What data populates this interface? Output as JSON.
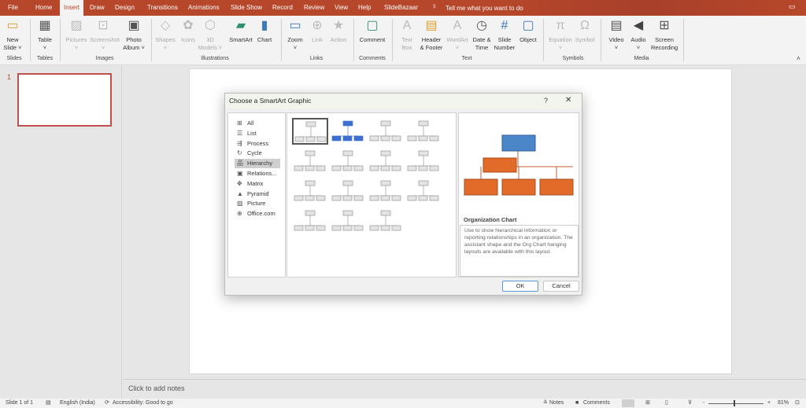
{
  "tabs": [
    "File",
    "Home",
    "Insert",
    "Draw",
    "Design",
    "Transitions",
    "Animations",
    "Slide Show",
    "Record",
    "Review",
    "View",
    "Help",
    "SlideBazaar"
  ],
  "active_tab": "Insert",
  "tell_me": "Tell me what you want to do",
  "ribbon": {
    "buttons": [
      {
        "label": "New\nSlide ˅",
        "icon": "new-slide-icon",
        "enabled": true
      },
      {
        "label": "Table\n˅",
        "icon": "table-icon",
        "enabled": true
      },
      {
        "label": "Pictures\n˅",
        "icon": "pictures-icon",
        "enabled": false
      },
      {
        "label": "Screenshot\n˅",
        "icon": "screenshot-icon",
        "enabled": false
      },
      {
        "label": "Photo\nAlbum ˅",
        "icon": "photo-album-icon",
        "enabled": true
      },
      {
        "label": "Shapes\n˅",
        "icon": "shapes-icon",
        "enabled": false
      },
      {
        "label": "Icons",
        "icon": "icons-icon",
        "enabled": false
      },
      {
        "label": "3D\nModels ˅",
        "icon": "3d-models-icon",
        "enabled": false
      },
      {
        "label": "SmartArt",
        "icon": "smartart-icon",
        "enabled": true
      },
      {
        "label": "Chart",
        "icon": "chart-icon",
        "enabled": true
      },
      {
        "label": "Zoom\n˅",
        "icon": "zoom-icon",
        "enabled": true
      },
      {
        "label": "Link",
        "icon": "link-icon",
        "enabled": false
      },
      {
        "label": "Action",
        "icon": "action-icon",
        "enabled": false
      },
      {
        "label": "Comment",
        "icon": "comment-icon",
        "enabled": true
      },
      {
        "label": "Text\nBox",
        "icon": "text-box-icon",
        "enabled": false
      },
      {
        "label": "Header\n& Footer",
        "icon": "header-footer-icon",
        "enabled": true
      },
      {
        "label": "WordArt\n˅",
        "icon": "wordart-icon",
        "enabled": false
      },
      {
        "label": "Date &\nTime",
        "icon": "date-time-icon",
        "enabled": true
      },
      {
        "label": "Slide\nNumber",
        "icon": "slide-number-icon",
        "enabled": true
      },
      {
        "label": "Object",
        "icon": "object-icon",
        "enabled": true
      },
      {
        "label": "Equation\n˅",
        "icon": "equation-icon",
        "enabled": false
      },
      {
        "label": "Symbol",
        "icon": "symbol-icon",
        "enabled": false
      },
      {
        "label": "Video\n˅",
        "icon": "video-icon",
        "enabled": true
      },
      {
        "label": "Audio\n˅",
        "icon": "audio-icon",
        "enabled": true
      },
      {
        "label": "Screen\nRecording",
        "icon": "screen-recording-icon",
        "enabled": true
      }
    ],
    "groups": [
      "Slides",
      "Tables",
      "Images",
      "Illustrations",
      "Links",
      "Comments",
      "Text",
      "Symbols",
      "Media"
    ]
  },
  "thumbnail": {
    "number": "1"
  },
  "notes_placeholder": "Click to add notes",
  "dialog": {
    "title": "Choose a SmartArt Graphic",
    "help": "?",
    "close": "✕",
    "categories": [
      "All",
      "List",
      "Process",
      "Cycle",
      "Hierarchy",
      "Relations...",
      "Matrix",
      "Pyramid",
      "Picture",
      "Office.com"
    ],
    "selected_category": "Hierarchy",
    "preview_title": "Organization Chart",
    "description": "Use to show hierarchical information or reporting relationships in an organization. The assistant shape and the Org Chart hanging layouts are available with this layout.",
    "ok": "OK",
    "cancel": "Cancel",
    "colors": {
      "preview_top": "#4a86c8",
      "preview_child": "#e26b2a",
      "selected_thumb_blue": "#3c6fcf"
    }
  },
  "status": {
    "slide": "Slide 1 of 1",
    "language": "English (India)",
    "accessibility": "Accessibility: Good to go",
    "notes": "Notes",
    "comments": "Comments",
    "zoom": "81%"
  },
  "colors": {
    "accent": "#b7472a"
  }
}
